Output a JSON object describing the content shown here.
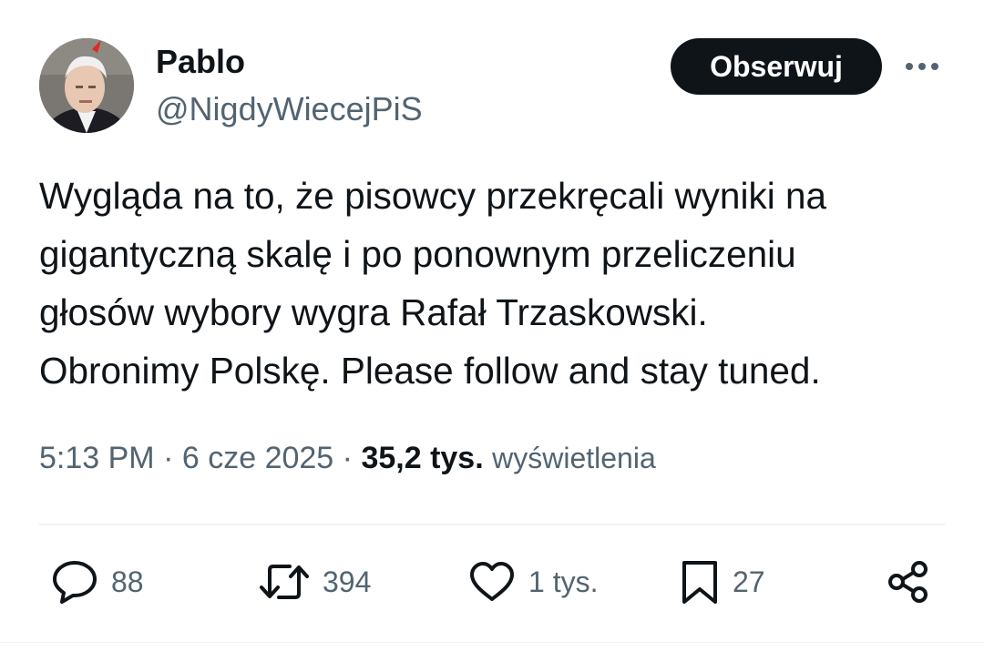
{
  "author": {
    "display_name": "Pablo",
    "handle": "@NigdyWiecejPiS",
    "avatar_icon": "profile-photo"
  },
  "follow_button": {
    "label": "Obserwuj"
  },
  "more_menu": {
    "icon": "more-horizontal-icon"
  },
  "tweet": {
    "lines": [
      "Wygląda na to, że pisowcy przekręcali wyniki na",
      "gigantyczną skalę i po ponownym przeliczeniu",
      "głosów wybory wygra Rafał Trzaskowski.",
      "Obronimy Polskę. Please follow and stay tuned."
    ]
  },
  "meta": {
    "time": "5:13 PM",
    "separator": "·",
    "date": "6 cze 2025",
    "views_count": "35,2 tys.",
    "views_label": "wyświetlenia"
  },
  "actions": {
    "reply": {
      "icon": "reply-icon",
      "count": "88"
    },
    "repost": {
      "icon": "repost-icon",
      "count": "394"
    },
    "like": {
      "icon": "heart-icon",
      "count": "1 tys."
    },
    "bookmark": {
      "icon": "bookmark-icon",
      "count": "27"
    },
    "share": {
      "icon": "share-icon"
    }
  },
  "colors": {
    "text_primary": "#0f1419",
    "text_secondary": "#536471",
    "button_bg": "#0f1419",
    "divider": "#eff3f4"
  }
}
